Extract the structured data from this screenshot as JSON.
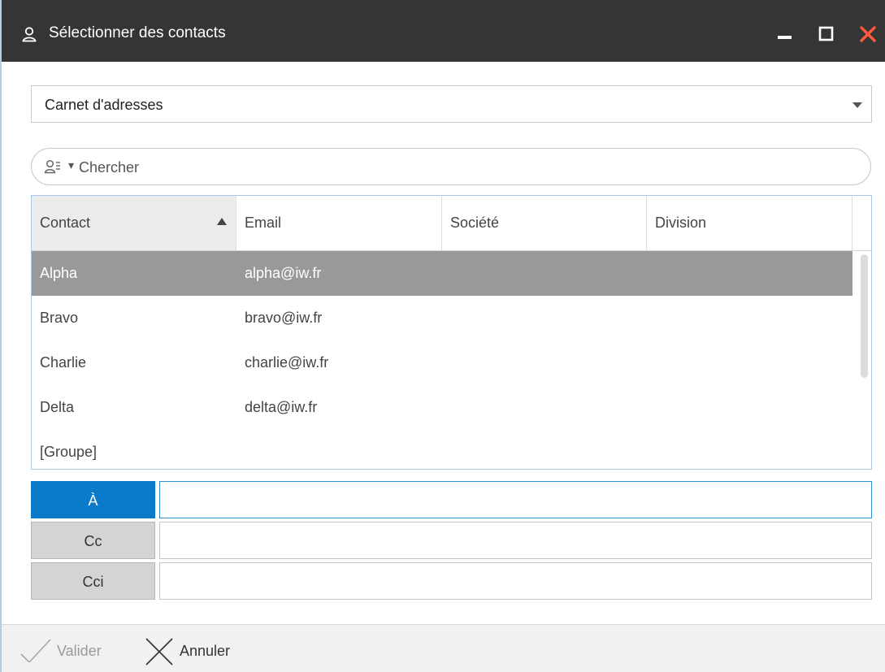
{
  "window": {
    "title": "Sélectionner des contacts",
    "controls": [
      "minimize-icon",
      "maximize-icon",
      "close-icon"
    ],
    "close_color": "#ff5a3c"
  },
  "addressbook": {
    "selected": "Carnet d'adresses"
  },
  "search": {
    "placeholder": "Chercher"
  },
  "grid": {
    "columns": [
      "Contact",
      "Email",
      "Société",
      "Division"
    ],
    "sorted_column": "Contact",
    "sort_direction": "ascending",
    "rows": [
      {
        "contact": "Alpha",
        "email": "alpha@iw.fr",
        "societe": "",
        "division": "",
        "selected": true
      },
      {
        "contact": "Bravo",
        "email": "bravo@iw.fr",
        "societe": "",
        "division": "",
        "selected": false
      },
      {
        "contact": "Charlie",
        "email": "charlie@iw.fr",
        "societe": "",
        "division": "",
        "selected": false
      },
      {
        "contact": "Delta",
        "email": "delta@iw.fr",
        "societe": "",
        "division": "",
        "selected": false
      },
      {
        "contact": "[Groupe]",
        "email": "",
        "societe": "",
        "division": "",
        "selected": false
      }
    ]
  },
  "recipients": [
    {
      "label": "À",
      "value": "",
      "active": true
    },
    {
      "label": "Cc",
      "value": "",
      "active": false
    },
    {
      "label": "Cci",
      "value": "",
      "active": false
    }
  ],
  "footer": {
    "validate_label": "Valider",
    "cancel_label": "Annuler"
  },
  "colors": {
    "titlebar": "#353535",
    "accent": "#0a7ac9",
    "selected_row": "#999999"
  }
}
